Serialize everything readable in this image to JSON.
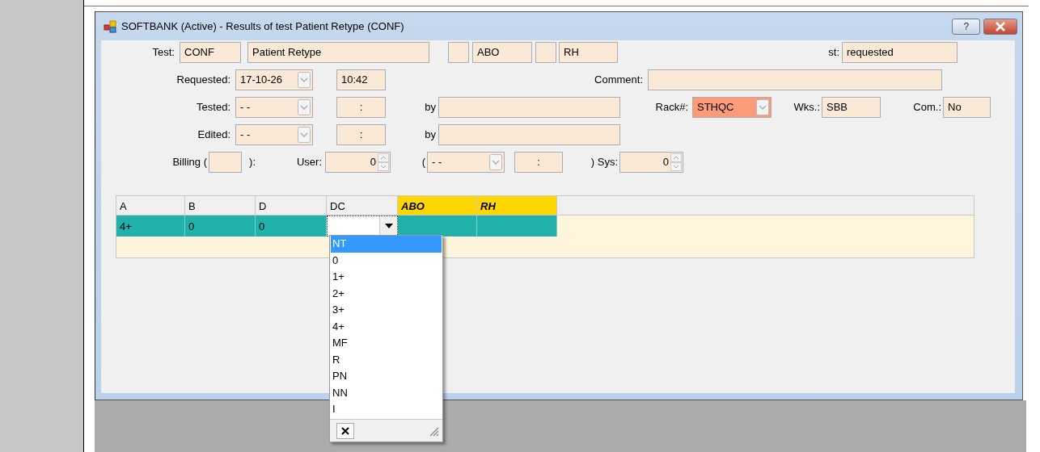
{
  "window": {
    "title": "SOFTBANK (Active) - Results of test Patient Retype (CONF)",
    "help_button": "?"
  },
  "form_rows": [
    [
      {
        "kind": "label",
        "text": "Test:"
      },
      {
        "kind": "text",
        "value": "CONF"
      },
      {
        "kind": "text",
        "value": "Patient Retype"
      },
      {
        "kind": "text"
      },
      {
        "kind": "text",
        "value": "ABO"
      },
      {
        "kind": "text"
      },
      {
        "kind": "text",
        "value": "RH"
      },
      {
        "kind": "label",
        "text": "st:"
      },
      {
        "kind": "text",
        "value": "requested"
      }
    ],
    [
      {
        "kind": "label",
        "text": "Requested:"
      },
      {
        "kind": "combo",
        "value": "17-10-26"
      },
      {
        "kind": "text",
        "value": "10:42"
      },
      {
        "kind": "label",
        "text": "Comment:"
      },
      {
        "kind": "text"
      }
    ],
    [
      {
        "kind": "label",
        "text": "Tested:"
      },
      {
        "kind": "combo",
        "value": "- -"
      },
      {
        "kind": "text",
        "value": ":",
        "centered": true
      },
      {
        "kind": "label",
        "text": "by"
      },
      {
        "kind": "text"
      },
      {
        "kind": "label",
        "text": "Rack#:"
      },
      {
        "kind": "combo",
        "value": "STHQC",
        "highlighted": true
      },
      {
        "kind": "label",
        "text": "Wks.:"
      },
      {
        "kind": "text",
        "value": "SBB"
      },
      {
        "kind": "label",
        "text": "Com.:"
      },
      {
        "kind": "text",
        "value": "No"
      }
    ],
    [
      {
        "kind": "label",
        "text": "Edited:"
      },
      {
        "kind": "combo",
        "value": "- -"
      },
      {
        "kind": "text",
        "value": ":",
        "centered": true
      },
      {
        "kind": "label",
        "text": "by"
      },
      {
        "kind": "text"
      }
    ],
    [
      {
        "kind": "label",
        "text": "Billing ("
      },
      {
        "kind": "text"
      },
      {
        "kind": "label",
        "text": "):"
      },
      {
        "kind": "label",
        "text": "User:"
      },
      {
        "kind": "spin",
        "value": "0"
      },
      {
        "kind": "label",
        "text": "("
      },
      {
        "kind": "combo",
        "value": "- -"
      },
      {
        "kind": "text",
        "value": ":",
        "centered": true
      },
      {
        "kind": "label",
        "text": ") Sys:"
      },
      {
        "kind": "spin",
        "value": "0"
      }
    ]
  ],
  "grid": {
    "columns": [
      {
        "label": "A",
        "highlighted": false
      },
      {
        "label": "B",
        "highlighted": false
      },
      {
        "label": "D",
        "highlighted": false
      },
      {
        "label": "DC",
        "highlighted": false
      },
      {
        "label": "ABO",
        "highlighted": true
      },
      {
        "label": "RH",
        "highlighted": true
      }
    ],
    "rows": [
      {
        "selected": true,
        "cells": [
          {
            "kind": "text",
            "value": "4+"
          },
          {
            "kind": "text",
            "value": "0"
          },
          {
            "kind": "text",
            "value": "0"
          },
          {
            "kind": "editor"
          },
          {
            "kind": "empty"
          },
          {
            "kind": "empty"
          }
        ]
      }
    ]
  },
  "dropdown": {
    "items": [
      {
        "label": "NT",
        "selected": true
      },
      {
        "label": "0",
        "selected": false
      },
      {
        "label": "1+",
        "selected": false
      },
      {
        "label": "2+",
        "selected": false
      },
      {
        "label": "3+",
        "selected": false
      },
      {
        "label": "4+",
        "selected": false
      },
      {
        "label": "MF",
        "selected": false
      },
      {
        "label": "R",
        "selected": false
      },
      {
        "label": "PN",
        "selected": false
      },
      {
        "label": "NN",
        "selected": false
      },
      {
        "label": "I",
        "selected": false
      }
    ]
  }
}
